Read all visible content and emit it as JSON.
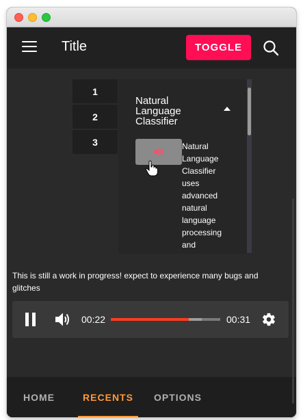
{
  "window": {
    "controls": [
      "close",
      "minimize",
      "maximize"
    ]
  },
  "appbar": {
    "title": "Title",
    "toggle_label": "TOGGLE",
    "menu_icon": "hamburger-menu-icon",
    "search_icon": "search-icon",
    "toggle_color": "#ff0d55"
  },
  "side_tabs": [
    "1",
    "2",
    "3"
  ],
  "panel": {
    "title": "Natural Language Classifier",
    "expanded": true,
    "description": "Natural Language Classifier uses advanced natural language processing and",
    "thumbnail_icon": "speaker-icon"
  },
  "notice": "This is still a work in progress! expect to experience many bugs and glitches",
  "player": {
    "state": "playing",
    "current_time": "00:22",
    "total_time": "00:31",
    "progress_fraction": 0.71,
    "buffered_fraction": 0.83,
    "progress_color": "#ff3d1f",
    "volume_icon": "volume-icon",
    "settings_icon": "gear-icon"
  },
  "bottom_nav": {
    "items": [
      "HOME",
      "RECENTS",
      "OPTIONS"
    ],
    "active_index": 1,
    "active_color": "#ff9a3a"
  }
}
